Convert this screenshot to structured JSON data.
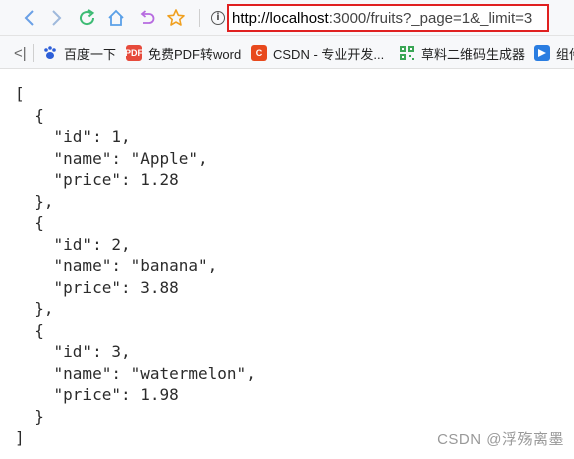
{
  "toolbar": {
    "buttons": [
      "back",
      "forward",
      "reload",
      "home",
      "undo",
      "favorite"
    ],
    "info_symbol": "i",
    "url_host": "http://localhost",
    "url_rest": ":3000/fruits?_page=1&_limit=3"
  },
  "bookmarks": {
    "collapse_symbol": "<|",
    "items": [
      {
        "label": "百度一下",
        "icon": "baidu-paw-icon"
      },
      {
        "label": "免费PDF转word",
        "icon": "pdf-icon"
      },
      {
        "label": "CSDN - 专业开发...",
        "icon": "csdn-icon"
      },
      {
        "label": "草料二维码生成器",
        "icon": "qr-code-icon"
      },
      {
        "label": "组件",
        "icon": "component-icon"
      }
    ],
    "icon_text": {
      "pdf": "PDF",
      "csdn": "C"
    }
  },
  "json_lines": [
    "[",
    "  {",
    "    \"id\": 1,",
    "    \"name\": \"Apple\",",
    "    \"price\": 1.28",
    "  },",
    "  {",
    "    \"id\": 2,",
    "    \"name\": \"banana\",",
    "    \"price\": 3.88",
    "  },",
    "  {",
    "    \"id\": 3,",
    "    \"name\": \"watermelon\",",
    "    \"price\": 1.98",
    "  }",
    "]"
  ],
  "watermark": "CSDN @浮殇离墨"
}
